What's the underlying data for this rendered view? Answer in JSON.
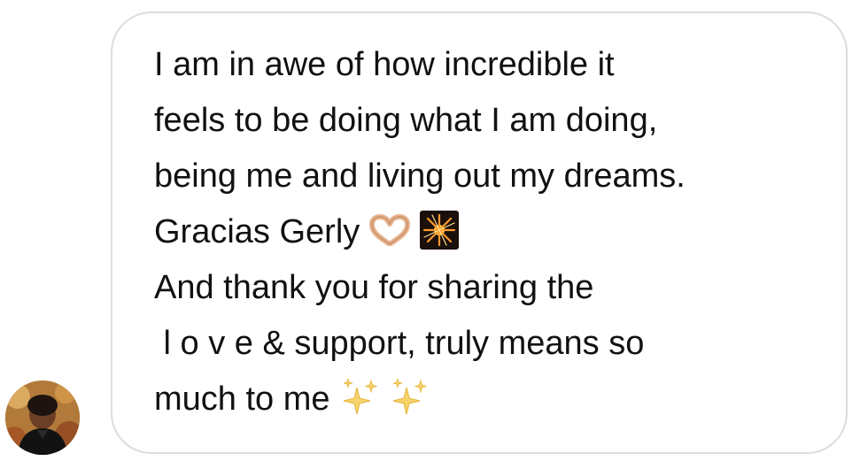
{
  "message": {
    "lines": [
      "I am in awe of how incredible it",
      "feels to be doing what I am doing,",
      "being me and living out my dreams.",
      "Gracias Gerly",
      "And thank you for sharing the",
      " l o v e & support, truly means so",
      "much to me"
    ],
    "emojis": {
      "line4": [
        "heart-hands-icon",
        "fireworks-icon"
      ],
      "line7": [
        "sparkles-icon",
        "sparkles-icon"
      ]
    }
  },
  "colors": {
    "bubble_border": "#dcdcdc",
    "text": "#111111",
    "background": "#ffffff"
  }
}
